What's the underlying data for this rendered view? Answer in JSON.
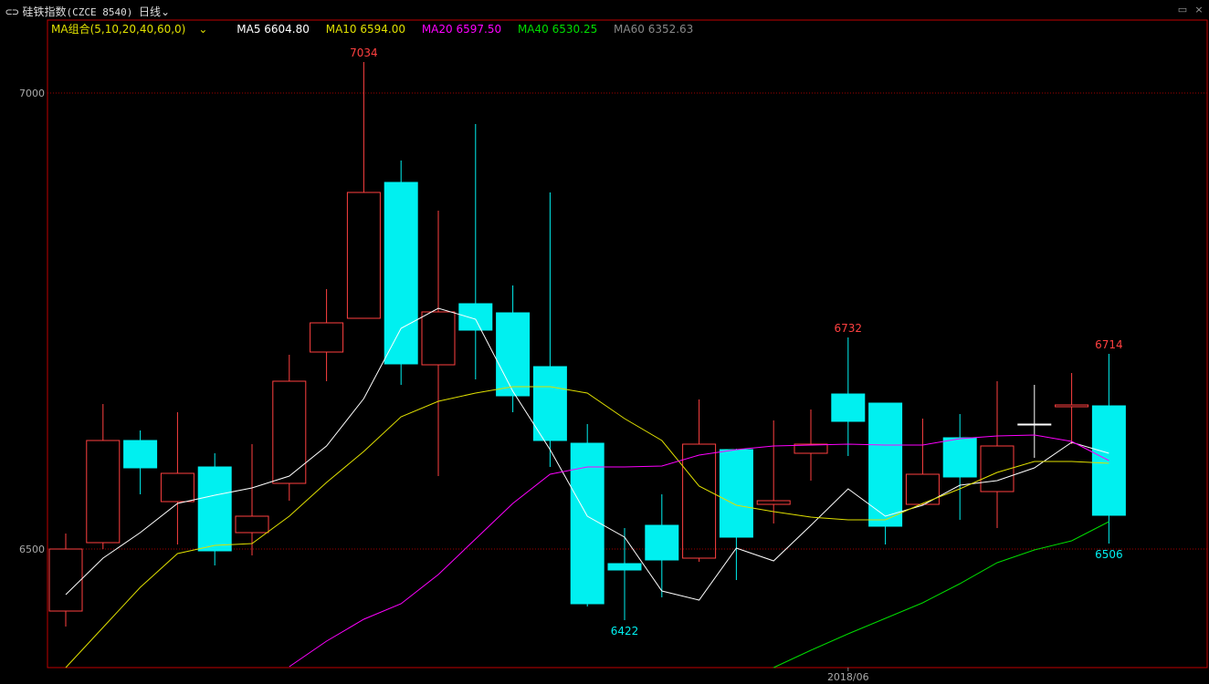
{
  "header": {
    "link_icon": "⊂⊃",
    "name": "硅铁指数",
    "code": "(CZCE 8540)",
    "period": "日线",
    "chevron": "⌄"
  },
  "legend": {
    "group_label": "MA组合(5,10,20,40,60,0)",
    "items": [
      {
        "label": "MA5 6604.80",
        "color": "#ffffff"
      },
      {
        "label": "MA10 6594.00",
        "color": "#e0e000"
      },
      {
        "label": "MA20 6597.50",
        "color": "#ff00ff"
      },
      {
        "label": "MA40 6530.25",
        "color": "#00dd00"
      },
      {
        "label": "MA60 6352.63",
        "color": "#888888"
      }
    ]
  },
  "colors": {
    "up": "#ff4040",
    "down": "#00f0f0",
    "grid": "#a00000",
    "frame": "#c00000",
    "flat": "#ffffff"
  },
  "chart_data": {
    "type": "candlestick",
    "ylim": [
      6370,
      7080
    ],
    "yticks": [
      6500,
      7000
    ],
    "x_ticks": [
      {
        "index": 21,
        "label": "2018/06"
      }
    ],
    "candles": [
      {
        "o": 6432,
        "c": 6500,
        "h": 6517,
        "l": 6415
      },
      {
        "o": 6507,
        "c": 6619,
        "h": 6659,
        "l": 6500
      },
      {
        "o": 6619,
        "c": 6589,
        "h": 6630,
        "l": 6560
      },
      {
        "o": 6552,
        "c": 6583,
        "h": 6650,
        "l": 6505
      },
      {
        "o": 6590,
        "c": 6498,
        "h": 6605,
        "l": 6482
      },
      {
        "o": 6518,
        "c": 6536,
        "h": 6615,
        "l": 6493
      },
      {
        "o": 6572,
        "c": 6684,
        "h": 6713,
        "l": 6553
      },
      {
        "o": 6716,
        "c": 6748,
        "h": 6785,
        "l": 6684
      },
      {
        "o": 6753,
        "c": 6891,
        "h": 7034,
        "l": 6753
      },
      {
        "o": 6902,
        "c": 6703,
        "h": 6926,
        "l": 6680
      },
      {
        "o": 6702,
        "c": 6760,
        "h": 6871,
        "l": 6580
      },
      {
        "o": 6769,
        "c": 6740,
        "h": 6966,
        "l": 6686
      },
      {
        "o": 6759,
        "c": 6668,
        "h": 6789,
        "l": 6650
      },
      {
        "o": 6700,
        "c": 6619,
        "h": 6891,
        "l": 6590
      },
      {
        "o": 6616,
        "c": 6440,
        "h": 6637,
        "l": 6437
      },
      {
        "o": 6484,
        "c": 6477,
        "h": 6523,
        "l": 6422
      },
      {
        "o": 6526,
        "c": 6488,
        "h": 6560,
        "l": 6447
      },
      {
        "o": 6490,
        "c": 6615,
        "h": 6664,
        "l": 6486
      },
      {
        "o": 6609,
        "c": 6513,
        "h": 6610,
        "l": 6466
      },
      {
        "o": 6549,
        "c": 6553,
        "h": 6641,
        "l": 6528
      },
      {
        "o": 6605,
        "c": 6615,
        "h": 6653,
        "l": 6575
      },
      {
        "o": 6670,
        "c": 6640,
        "h": 6732,
        "l": 6602
      },
      {
        "o": 6660,
        "c": 6525,
        "h": 6660,
        "l": 6505
      },
      {
        "o": 6549,
        "c": 6582,
        "h": 6643,
        "l": 6548
      },
      {
        "o": 6622,
        "c": 6579,
        "h": 6648,
        "l": 6532
      },
      {
        "o": 6563,
        "c": 6613,
        "h": 6684,
        "l": 6523
      },
      {
        "o": 6637,
        "c": 6637,
        "h": 6680,
        "l": 6600
      },
      {
        "o": 6656,
        "c": 6658,
        "h": 6693,
        "l": 6615
      },
      {
        "o": 6657,
        "c": 6537,
        "h": 6714,
        "l": 6506
      }
    ],
    "annotations": [
      {
        "index": 8,
        "value": 7034,
        "label": "7034",
        "pos": "above",
        "kind": "up"
      },
      {
        "index": 15,
        "value": 6422,
        "label": "6422",
        "pos": "below",
        "kind": "down"
      },
      {
        "index": 21,
        "value": 6732,
        "label": "6732",
        "pos": "above",
        "kind": "up"
      },
      {
        "index": 28,
        "value": 6714,
        "label": "6714",
        "pos": "above",
        "kind": "up"
      },
      {
        "index": 28,
        "value": 6506,
        "label": "6506",
        "pos": "below",
        "kind": "down"
      }
    ],
    "series": [
      {
        "name": "MA5",
        "color": "#ffffff",
        "start": 0,
        "values": [
          6450,
          6490,
          6518,
          6550,
          6559,
          6567,
          6580,
          6613,
          6665,
          6742,
          6764,
          6752,
          6673,
          6609,
          6536,
          6513,
          6454,
          6444,
          6501,
          6487,
          6526,
          6566,
          6536,
          6548,
          6570,
          6575,
          6589,
          6617,
          6605
        ]
      },
      {
        "name": "MA10",
        "color": "#e0e000",
        "start": 0,
        "values": [
          6370,
          6414,
          6458,
          6495,
          6504,
          6506,
          6536,
          6573,
          6607,
          6645,
          6662,
          6671,
          6678,
          6678,
          6671,
          6643,
          6619,
          6569,
          6548,
          6541,
          6535,
          6532,
          6532,
          6550,
          6566,
          6584,
          6596,
          6596,
          6594
        ]
      },
      {
        "name": "MA20",
        "color": "#ff00ff",
        "start": 6,
        "values": [
          6371,
          6399,
          6423,
          6440,
          6472,
          6511,
          6550,
          6582,
          6590,
          6590,
          6591,
          6603,
          6609,
          6613,
          6614,
          6615,
          6614,
          6614,
          6621,
          6624,
          6625,
          6618,
          6597
        ]
      },
      {
        "name": "MA40",
        "color": "#00dd00",
        "start": 19,
        "values": [
          6370,
          6389,
          6407,
          6424,
          6441,
          6462,
          6485,
          6499,
          6509,
          6530
        ]
      }
    ]
  }
}
